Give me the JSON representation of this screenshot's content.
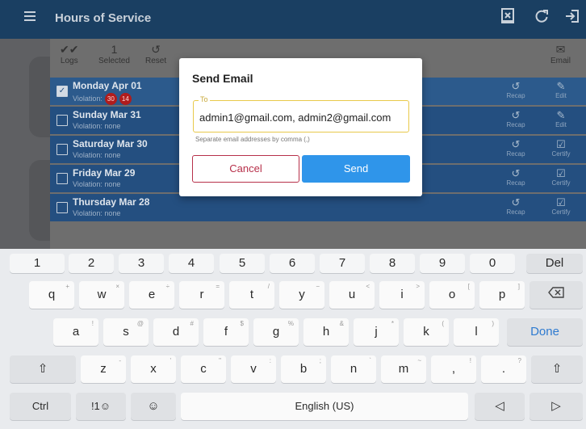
{
  "app": {
    "title": "Hours of Service",
    "actions": [
      "export-icon",
      "refresh-icon",
      "logout-icon"
    ]
  },
  "toolbar": {
    "logs_label": "Logs",
    "selected_count": "1",
    "selected_label": "Selected",
    "reset_label": "Reset",
    "email_label": "Email"
  },
  "rows": [
    {
      "day": "Monday Apr 01",
      "violation": "Violation:",
      "badges": [
        "30",
        "14"
      ],
      "checked": true,
      "a1": "Recap",
      "a2": "Edit"
    },
    {
      "day": "Sunday Mar 31",
      "violation": "Violation: none",
      "checked": false,
      "a1": "Recap",
      "a2": "Edit"
    },
    {
      "day": "Saturday Mar 30",
      "violation": "Violation: none",
      "checked": false,
      "a1": "Recap",
      "a2": "Certify"
    },
    {
      "day": "Friday Mar 29",
      "violation": "Violation: none",
      "checked": false,
      "a1": "Recap",
      "a2": "Certify"
    },
    {
      "day": "Thursday Mar 28",
      "violation": "Violation: none",
      "checked": false,
      "a1": "Recap",
      "a2": "Certify"
    }
  ],
  "dialog": {
    "title": "Send Email",
    "to_label": "To",
    "to_value": "admin1@gmail.com, admin2@gmail.com",
    "hint": "Separate email addresses by comma (,)",
    "cancel_label": "Cancel",
    "send_label": "Send"
  },
  "keyboard": {
    "numbers": [
      "1",
      "2",
      "3",
      "4",
      "5",
      "6",
      "7",
      "8",
      "9",
      "0"
    ],
    "del_label": "Del",
    "row1": [
      [
        "q",
        "+"
      ],
      [
        "w",
        "×"
      ],
      [
        "e",
        "÷"
      ],
      [
        "r",
        "="
      ],
      [
        "t",
        "/"
      ],
      [
        "y",
        "−"
      ],
      [
        "u",
        "<"
      ],
      [
        "i",
        ">"
      ],
      [
        "o",
        "["
      ],
      [
        "p",
        "]"
      ]
    ],
    "row2": [
      [
        "a",
        "!"
      ],
      [
        "s",
        "@"
      ],
      [
        "d",
        "#"
      ],
      [
        "f",
        "$"
      ],
      [
        "g",
        "%"
      ],
      [
        "h",
        "&"
      ],
      [
        "j",
        "*"
      ],
      [
        "k",
        "("
      ],
      [
        "l",
        ")"
      ]
    ],
    "done_label": "Done",
    "row3": [
      [
        "z",
        "-"
      ],
      [
        "x",
        "'"
      ],
      [
        "c",
        "\""
      ],
      [
        "v",
        ":"
      ],
      [
        "b",
        ";"
      ],
      [
        "n",
        "`"
      ],
      [
        "m",
        "~"
      ],
      [
        ",",
        "!"
      ],
      [
        ".",
        "?"
      ]
    ],
    "ctrl_label": "Ctrl",
    "symbols_label": "!1☺",
    "space_label": "English (US)",
    "colors": {
      "appbar": "#1a3f62",
      "row": "#244f80",
      "send": "#2f95ea",
      "cancel": "#b7304a",
      "badge": "#b01c1c"
    }
  }
}
